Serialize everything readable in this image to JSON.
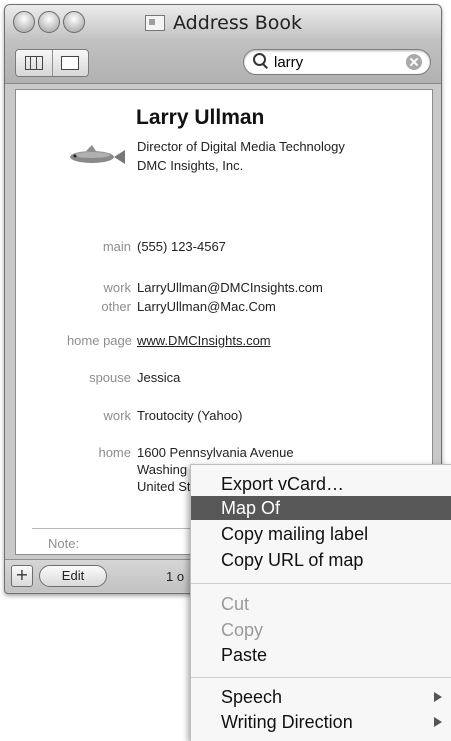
{
  "window": {
    "title": "Address Book"
  },
  "search": {
    "value": "larry"
  },
  "card": {
    "name": "Larry Ullman",
    "job_title": "Director of Digital Media Technology",
    "company": "DMC Insights, Inc.",
    "fields": [
      {
        "label": "main",
        "value": "(555) 123-4567"
      },
      {
        "label": "work",
        "value": "LarryUllman@DMCInsights.com"
      },
      {
        "label": "other",
        "value": "LarryUllman@Mac.Com"
      },
      {
        "label": "home page",
        "value": "www.DMCInsights.com"
      },
      {
        "label": "spouse",
        "value": "Jessica"
      },
      {
        "label": "work",
        "value": "Troutocity (Yahoo)"
      },
      {
        "label": "home",
        "value": "1600 Pennsylvania Avenue"
      }
    ],
    "address_lines_visible": [
      "Washing",
      "United St"
    ],
    "note_label": "Note:"
  },
  "bottom_bar": {
    "add_label": "+",
    "edit_label": "Edit",
    "count_text": "1 o"
  },
  "context_menu": {
    "items": [
      {
        "label": "Export vCard…",
        "state": "normal"
      },
      {
        "label": "Map Of",
        "state": "highlighted"
      },
      {
        "label": "Copy mailing label",
        "state": "normal"
      },
      {
        "label": "Copy URL of map",
        "state": "normal"
      },
      {
        "label": "Cut",
        "state": "disabled"
      },
      {
        "label": "Copy",
        "state": "disabled"
      },
      {
        "label": "Paste",
        "state": "normal"
      },
      {
        "label": "Speech",
        "state": "submenu"
      },
      {
        "label": "Writing Direction",
        "state": "submenu"
      }
    ]
  },
  "icons": {
    "window_controls": [
      "close-icon",
      "minimize-icon",
      "zoom-icon"
    ],
    "search": "search-icon",
    "clear": "clear-search-icon",
    "photo": "fish-photo"
  },
  "colors": {
    "menu_highlight": "#575757",
    "label_gray": "#8e8e8e"
  }
}
